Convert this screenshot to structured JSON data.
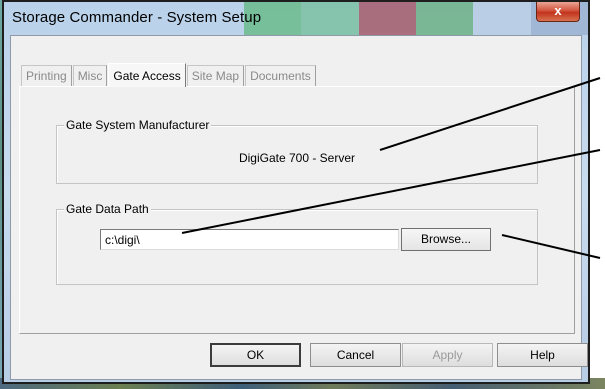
{
  "window": {
    "title": "Storage Commander - System Setup",
    "close_glyph": "x"
  },
  "tabs": [
    {
      "label": "Printing",
      "active": false
    },
    {
      "label": "Misc",
      "active": false
    },
    {
      "label": "Gate Access",
      "active": true
    },
    {
      "label": "Site Map",
      "active": false
    },
    {
      "label": "Documents",
      "active": false
    }
  ],
  "gate_system": {
    "group_label": "Gate System Manufacturer",
    "value": "DigiGate 700 - Server"
  },
  "gate_data_path": {
    "group_label": "Gate Data Path",
    "path_value": "c:\\digi\\",
    "browse_label": "Browse..."
  },
  "buttons": {
    "ok": "OK",
    "cancel": "Cancel",
    "apply": "Apply",
    "help": "Help"
  },
  "colors": {
    "title_stripes": [
      "#4fae4f",
      "#3fa86a",
      "#9b1b24",
      "#3a9a45",
      "#b7c7d6"
    ],
    "annotation": "#000000"
  },
  "icons": {
    "close": "close-icon",
    "annotation_arrows": "annotation-arrow-icon"
  }
}
